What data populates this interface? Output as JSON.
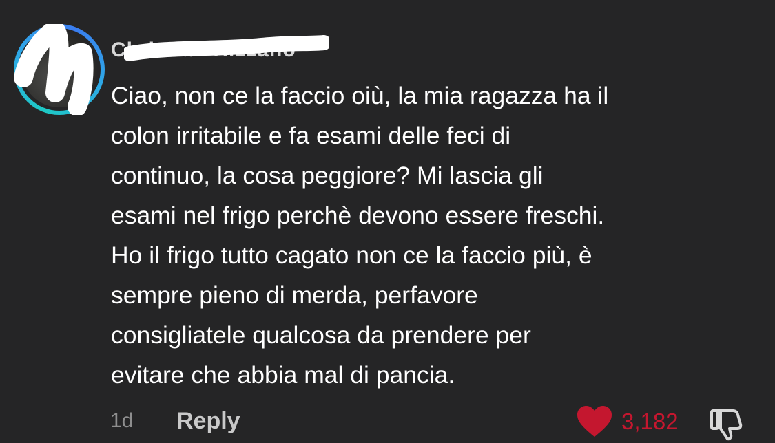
{
  "comment": {
    "username": "Christian Rizzano",
    "body_lines": [
      "Ciao, non ce la faccio oiù, la mia ragazza ha il",
      "colon irritabile e fa esami delle feci di",
      "continuo, la cosa peggiore? Mi lascia gli",
      "esami nel frigo perchè devono essere freschi.",
      "Ho il frigo tutto cagato non ce la faccio più, è",
      "sempre pieno di merda, perfavore",
      "consigliatele qualcosa da prendere per",
      "evitare che abbia mal di pancia."
    ],
    "age": "1d",
    "reply_label": "Reply",
    "like_count": "3,182",
    "liked": true
  },
  "icons": {
    "like": "heart-icon",
    "dislike": "thumbs-down-icon"
  },
  "colors": {
    "background": "#252526",
    "like_red": "#c4172f",
    "avatar_ring": "#2ea9e6"
  }
}
